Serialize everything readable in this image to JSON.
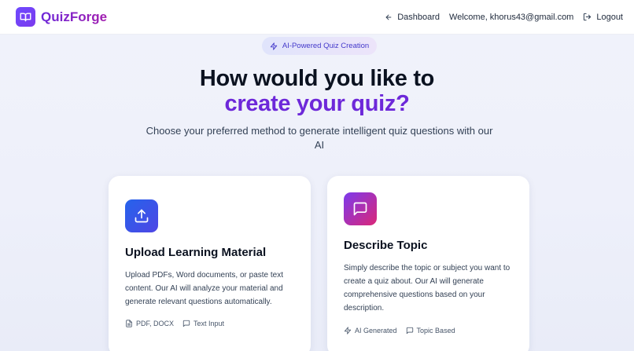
{
  "brand": {
    "name": "QuizForge",
    "logo_icon": "book-open-icon",
    "accent": "#6d4aff"
  },
  "nav": {
    "dashboard_label": "Dashboard",
    "welcome_text": "Welcome, khorus43@gmail.com",
    "logout_label": "Logout"
  },
  "hero": {
    "badge_label": "AI-Powered Quiz Creation",
    "title_line1": "How would you like to",
    "title_line2": "create your quiz?",
    "subtitle": "Choose your preferred method to generate intelligent quiz questions with our AI"
  },
  "cards": [
    {
      "icon": "upload-icon",
      "title": "Upload Learning Material",
      "description": "Upload PDFs, Word documents, or paste text content. Our AI will analyze your material and generate relevant questions automatically.",
      "tags": [
        {
          "icon": "file-icon",
          "label": "PDF, DOCX"
        },
        {
          "icon": "message-icon",
          "label": "Text Input"
        }
      ]
    },
    {
      "icon": "message-square-icon",
      "title": "Describe Topic",
      "description": "Simply describe the topic or subject you want to create a quiz about. Our AI will generate comprehensive questions based on your description.",
      "tags": [
        {
          "icon": "zap-icon",
          "label": "AI Generated"
        },
        {
          "icon": "message-icon",
          "label": "Topic Based"
        }
      ]
    }
  ]
}
